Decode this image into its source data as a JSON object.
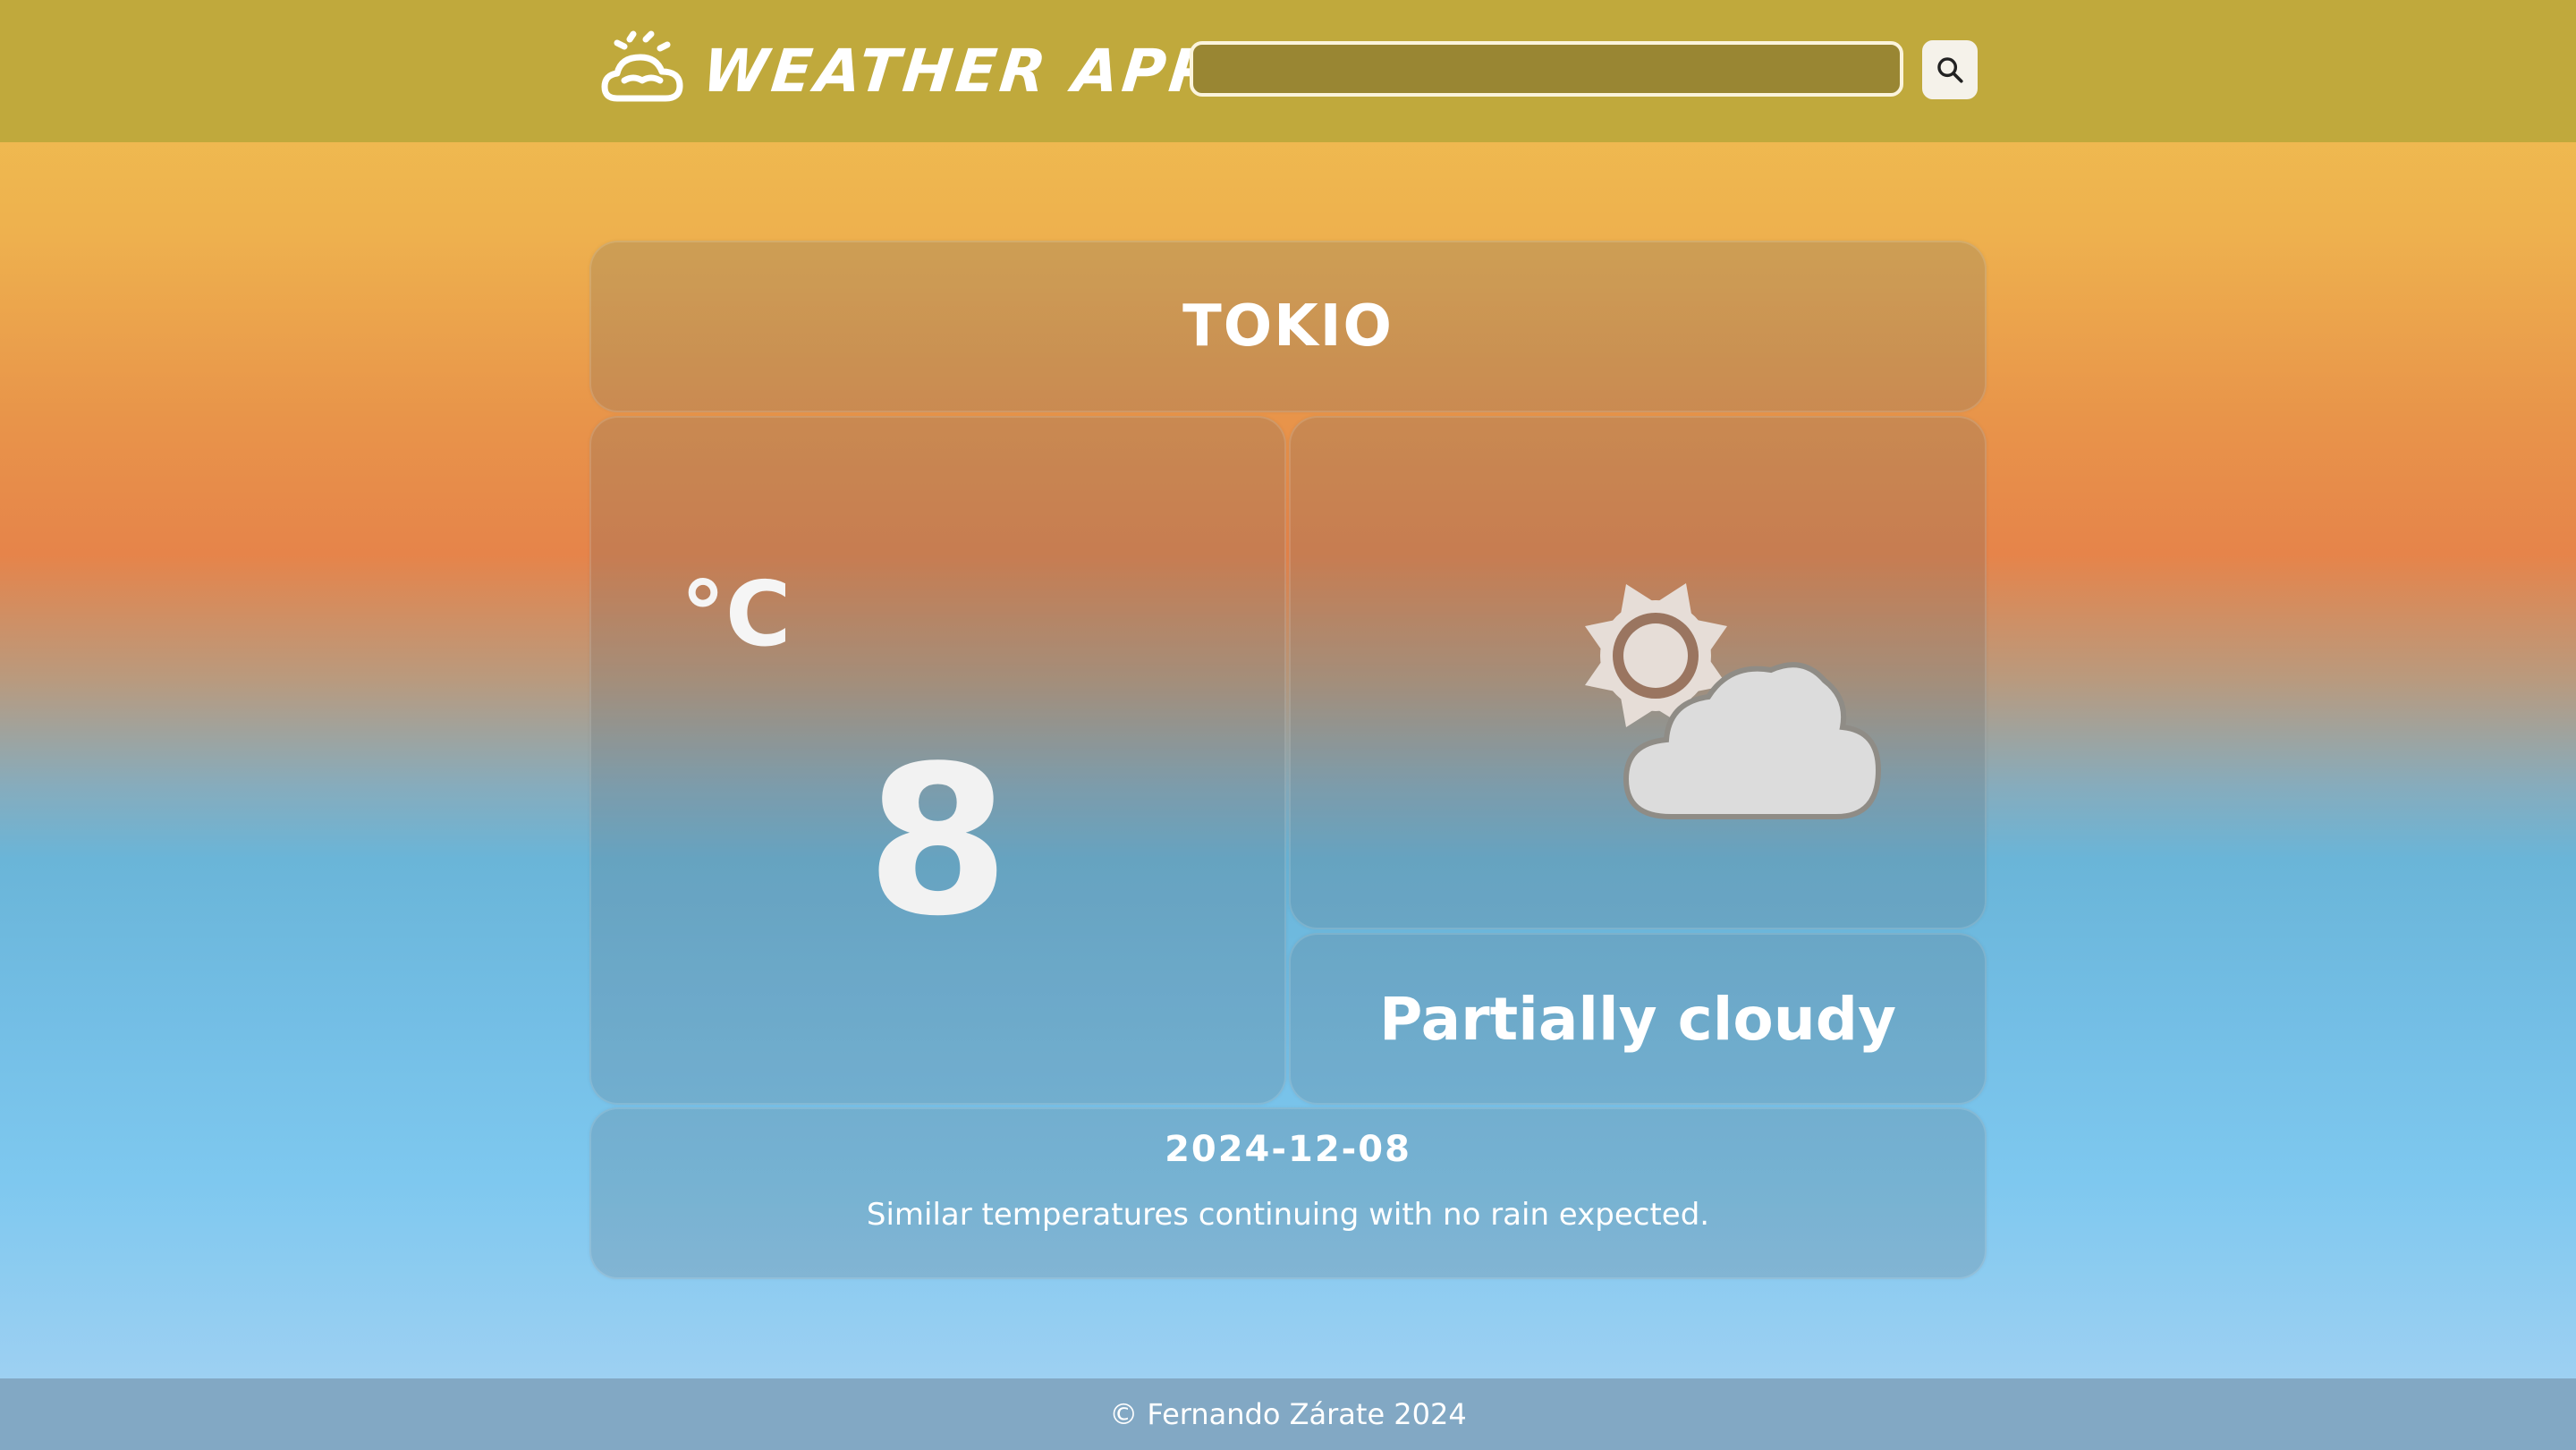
{
  "header": {
    "app_title": "WEATHER APP",
    "logo_icon": "sun-cloud-icon",
    "search": {
      "value": "",
      "placeholder": "",
      "button_icon": "search-icon"
    }
  },
  "weather": {
    "city": "TOKIO",
    "temperature_unit": "°C",
    "temperature": "8",
    "icon": "partly-cloudy-day-icon",
    "condition": "Partially cloudy",
    "date": "2024-12-08",
    "description": "Similar temperatures continuing with no rain expected."
  },
  "footer": {
    "copyright": "© Fernando Zárate 2024"
  },
  "colors": {
    "header_bg": "#c0a93c",
    "search_bg": "#998633",
    "footer_bg": "#82a8c4",
    "text": "#ffffff",
    "icon_light": "#e4dcd8"
  }
}
